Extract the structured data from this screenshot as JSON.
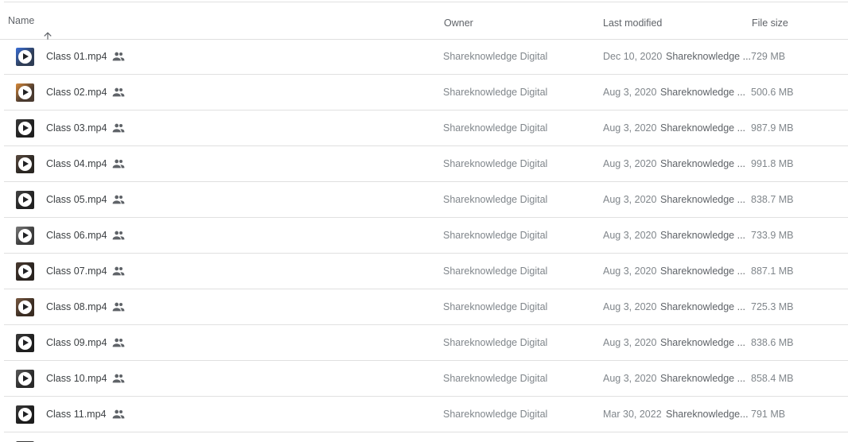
{
  "header": {
    "name": "Name",
    "owner": "Owner",
    "last_modified": "Last modified",
    "file_size": "File size",
    "sort_icon": "arrow-up-icon"
  },
  "files": [
    {
      "name": "Class 01.mp4",
      "owner": "Shareknowledge Digital",
      "date": "Dec 10, 2020",
      "modified_by": "Shareknowledge ...",
      "size": "729 MB",
      "thumb_color": "#2f3d55",
      "thumb_accent": "#3a6fd8"
    },
    {
      "name": "Class 02.mp4",
      "owner": "Shareknowledge Digital",
      "date": "Aug 3, 2020",
      "modified_by": "Shareknowledge ...",
      "size": "500.6 MB",
      "thumb_color": "#4a3a30",
      "thumb_accent": "#d88a3a"
    },
    {
      "name": "Class 03.mp4",
      "owner": "Shareknowledge Digital",
      "date": "Aug 3, 2020",
      "modified_by": "Shareknowledge ...",
      "size": "987.9 MB",
      "thumb_color": "#1f1f1f",
      "thumb_accent": "#3a3a3a"
    },
    {
      "name": "Class 04.mp4",
      "owner": "Shareknowledge Digital",
      "date": "Aug 3, 2020",
      "modified_by": "Shareknowledge ...",
      "size": "991.8 MB",
      "thumb_color": "#2a2622",
      "thumb_accent": "#5a4a3e"
    },
    {
      "name": "Class 05.mp4",
      "owner": "Shareknowledge Digital",
      "date": "Aug 3, 2020",
      "modified_by": "Shareknowledge ...",
      "size": "838.7 MB",
      "thumb_color": "#222222",
      "thumb_accent": "#444444"
    },
    {
      "name": "Class 06.mp4",
      "owner": "Shareknowledge Digital",
      "date": "Aug 3, 2020",
      "modified_by": "Shareknowledge ...",
      "size": "733.9 MB",
      "thumb_color": "#3a3a3a",
      "thumb_accent": "#7a7a7a"
    },
    {
      "name": "Class 07.mp4",
      "owner": "Shareknowledge Digital",
      "date": "Aug 3, 2020",
      "modified_by": "Shareknowledge ...",
      "size": "887.1 MB",
      "thumb_color": "#2a2420",
      "thumb_accent": "#4a3a30"
    },
    {
      "name": "Class 08.mp4",
      "owner": "Shareknowledge Digital",
      "date": "Aug 3, 2020",
      "modified_by": "Shareknowledge ...",
      "size": "725.3 MB",
      "thumb_color": "#3a2c22",
      "thumb_accent": "#7a5a42"
    },
    {
      "name": "Class 09.mp4",
      "owner": "Shareknowledge Digital",
      "date": "Aug 3, 2020",
      "modified_by": "Shareknowledge ...",
      "size": "838.6 MB",
      "thumb_color": "#1e1e1e",
      "thumb_accent": "#3a3a3a"
    },
    {
      "name": "Class 10.mp4",
      "owner": "Shareknowledge Digital",
      "date": "Aug 3, 2020",
      "modified_by": "Shareknowledge ...",
      "size": "858.4 MB",
      "thumb_color": "#2a2a2a",
      "thumb_accent": "#5a5a5a"
    },
    {
      "name": "Class 11.mp4",
      "owner": "Shareknowledge Digital",
      "date": "Mar 30, 2022",
      "modified_by": "Shareknowledge...",
      "size": "791 MB",
      "thumb_color": "#1c1c1c",
      "thumb_accent": "#3a3a3a"
    }
  ],
  "icons": {
    "shared": "people-icon",
    "file_type": "video-play-icon"
  }
}
